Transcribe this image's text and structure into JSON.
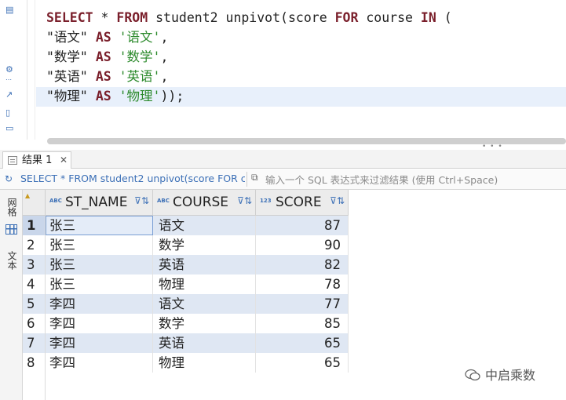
{
  "editor": {
    "lines": [
      [
        {
          "t": "SELECT",
          "c": "kw"
        },
        {
          "t": " ",
          "c": "pn"
        },
        {
          "t": "*",
          "c": "pn"
        },
        {
          "t": " ",
          "c": "pn"
        },
        {
          "t": "FROM",
          "c": "kw"
        },
        {
          "t": " student2 unpivot(score ",
          "c": "id"
        },
        {
          "t": "FOR",
          "c": "kw"
        },
        {
          "t": " course ",
          "c": "id"
        },
        {
          "t": "IN",
          "c": "kw"
        },
        {
          "t": " (",
          "c": "pn"
        }
      ],
      [
        {
          "t": "\"语文\"",
          "c": "dq"
        },
        {
          "t": " ",
          "c": "pn"
        },
        {
          "t": "AS",
          "c": "kw"
        },
        {
          "t": " ",
          "c": "pn"
        },
        {
          "t": "'语文'",
          "c": "sq"
        },
        {
          "t": ",",
          "c": "pn"
        }
      ],
      [
        {
          "t": "\"数学\"",
          "c": "dq"
        },
        {
          "t": " ",
          "c": "pn"
        },
        {
          "t": "AS",
          "c": "kw"
        },
        {
          "t": " ",
          "c": "pn"
        },
        {
          "t": "'数学'",
          "c": "sq"
        },
        {
          "t": ",",
          "c": "pn"
        }
      ],
      [
        {
          "t": "\"英语\"",
          "c": "dq"
        },
        {
          "t": " ",
          "c": "pn"
        },
        {
          "t": "AS",
          "c": "kw"
        },
        {
          "t": " ",
          "c": "pn"
        },
        {
          "t": "'英语'",
          "c": "sq"
        },
        {
          "t": ",",
          "c": "pn"
        }
      ],
      [
        {
          "t": "\"物理\"",
          "c": "dq"
        },
        {
          "t": " ",
          "c": "pn"
        },
        {
          "t": "AS",
          "c": "kw"
        },
        {
          "t": " ",
          "c": "pn"
        },
        {
          "t": "'物理'",
          "c": "sq"
        },
        {
          "t": "));",
          "c": "pn"
        }
      ]
    ]
  },
  "results": {
    "tab_label": "结果 1",
    "tab_close": "✕",
    "query_text": "SELECT * FROM student2 unpivot(score FOR c",
    "filter_placeholder": "输入一个 SQL 表达式来过滤结果 (使用 Ctrl+Space)",
    "side_tabs": {
      "grid": "网格",
      "text": "文本"
    },
    "columns": [
      {
        "type_badge": "ABC",
        "name": "ST_NAME"
      },
      {
        "type_badge": "ABC",
        "name": "COURSE"
      },
      {
        "type_badge": "123",
        "name": "SCORE"
      }
    ],
    "rows": [
      {
        "n": "1",
        "st_name": "张三",
        "course": "语文",
        "score": "87"
      },
      {
        "n": "2",
        "st_name": "张三",
        "course": "数学",
        "score": "90"
      },
      {
        "n": "3",
        "st_name": "张三",
        "course": "英语",
        "score": "82"
      },
      {
        "n": "4",
        "st_name": "张三",
        "course": "物理",
        "score": "78"
      },
      {
        "n": "5",
        "st_name": "李四",
        "course": "语文",
        "score": "77"
      },
      {
        "n": "6",
        "st_name": "李四",
        "course": "数学",
        "score": "85"
      },
      {
        "n": "7",
        "st_name": "李四",
        "course": "英语",
        "score": "65"
      },
      {
        "n": "8",
        "st_name": "李四",
        "course": "物理",
        "score": "65"
      }
    ]
  },
  "watermark": {
    "text": "中启乘数"
  },
  "colors": {
    "keyword": "#7a1f2b",
    "string": "#2c8a2c",
    "accent": "#3b6fb6",
    "row_alt": "#dfe7f3"
  }
}
